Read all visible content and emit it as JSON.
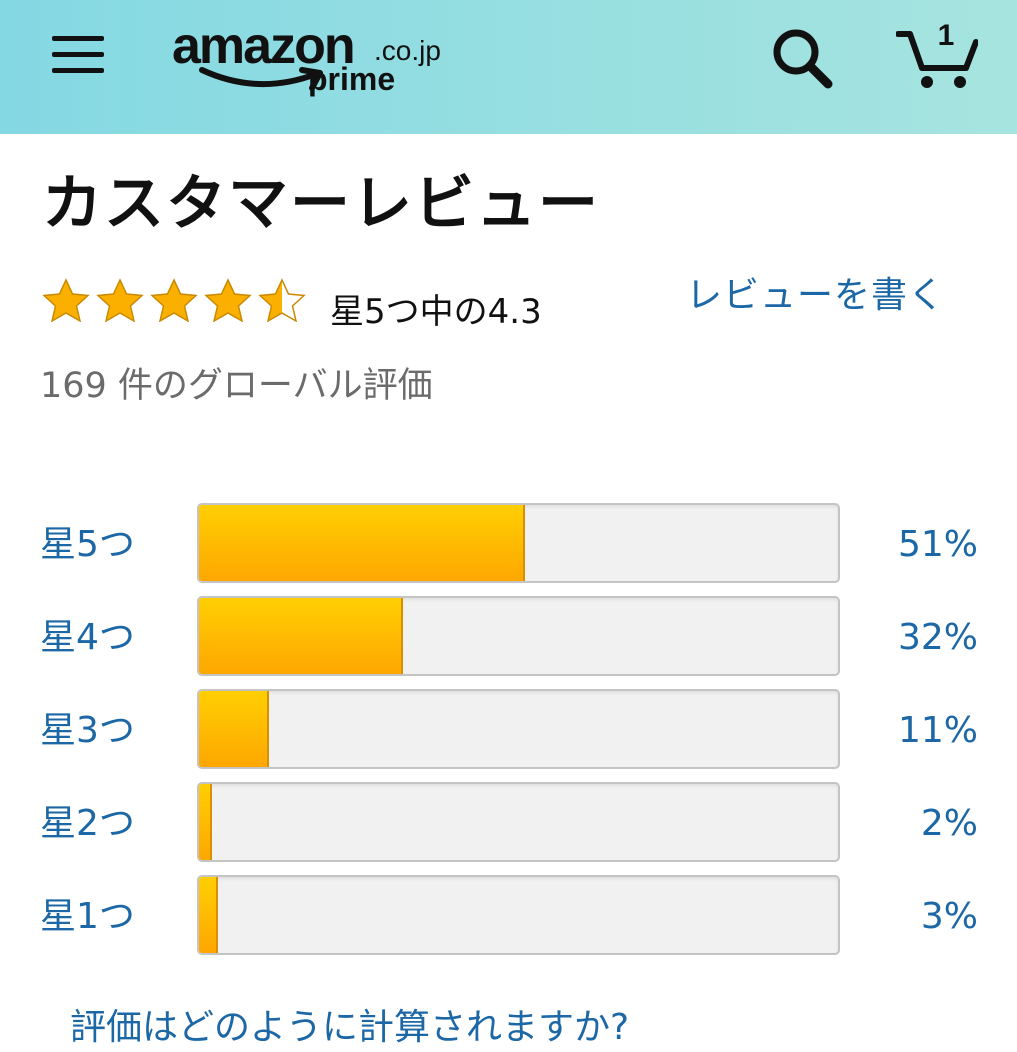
{
  "header": {
    "logo_word": "amazon",
    "logo_domain": ".co.jp",
    "logo_sub": "prime",
    "cart_count": "1",
    "background_colors": [
      "#84d8e3",
      "#a6e4df"
    ]
  },
  "reviews": {
    "title": "カスタマーレビュー",
    "average_rating": 4.3,
    "max_rating": 5,
    "rating_text": "星5つ中の4.3",
    "write_review_label": "レビューを書く",
    "global_count_text": "169 件のグローバル評価",
    "histogram": [
      {
        "label": "星5つ",
        "percent_text": "51%",
        "percent": 51
      },
      {
        "label": "星4つ",
        "percent_text": "32%",
        "percent": 32
      },
      {
        "label": "星3つ",
        "percent_text": "11%",
        "percent": 11
      },
      {
        "label": "星2つ",
        "percent_text": "2%",
        "percent": 2
      },
      {
        "label": "星1つ",
        "percent_text": "3%",
        "percent": 3
      }
    ],
    "how_calculated_link": "評価はどのように計算されますか?"
  },
  "colors": {
    "link": "#1c67a5",
    "star": "#fbb000",
    "bar_fill": "#fea701",
    "bar_track": "#f1f1f1",
    "muted_text": "#6b6b6b"
  },
  "icons": [
    "menu-icon",
    "search-icon",
    "cart-icon",
    "star-icon",
    "half-star-icon"
  ]
}
